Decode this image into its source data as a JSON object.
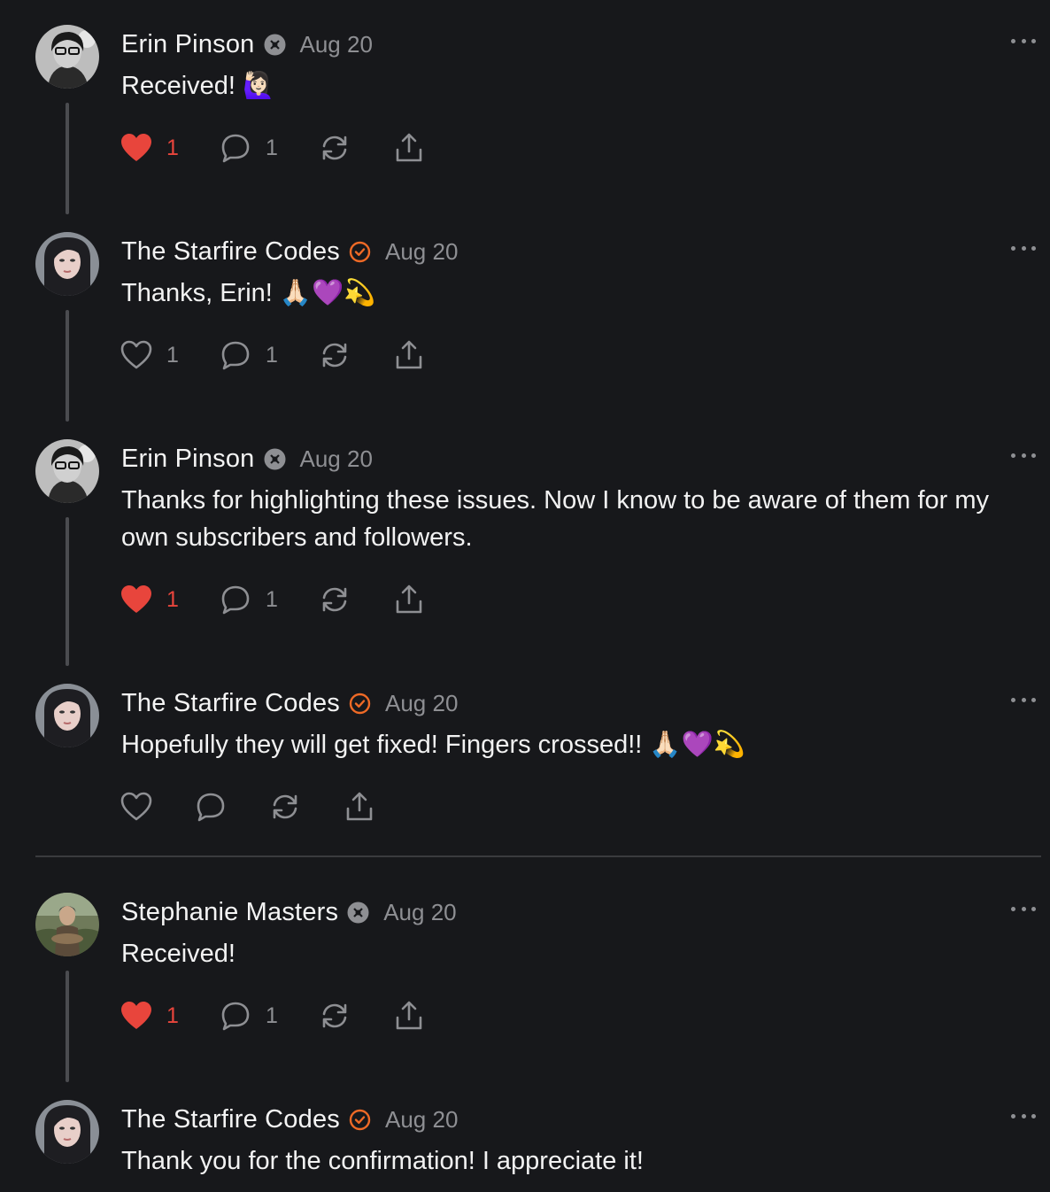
{
  "posts": [
    {
      "name": "Erin Pinson",
      "badge": "community-badge",
      "date": "Aug 20",
      "text": "Received! 🙋🏻‍♀️",
      "likes": "1",
      "liked": true,
      "comments": "1",
      "avatar": "erin"
    },
    {
      "name": "The Starfire Codes",
      "badge": "verified-badge",
      "date": "Aug 20",
      "text": "Thanks, Erin! 🙏🏻💜💫",
      "likes": "1",
      "liked": false,
      "comments": "1",
      "avatar": "starfire"
    },
    {
      "name": "Erin Pinson",
      "badge": "community-badge",
      "date": "Aug 20",
      "text": "Thanks for highlighting these issues. Now I know to be aware of them for my own subscribers and followers.",
      "likes": "1",
      "liked": true,
      "comments": "1",
      "avatar": "erin"
    },
    {
      "name": "The Starfire Codes",
      "badge": "verified-badge",
      "date": "Aug 20",
      "text": "Hopefully they will get fixed! Fingers crossed!! 🙏🏻💜💫",
      "likes": "",
      "liked": false,
      "comments": "",
      "avatar": "starfire"
    },
    {
      "name": "Stephanie Masters",
      "badge": "community-badge",
      "date": "Aug 20",
      "text": "Received!",
      "likes": "1",
      "liked": true,
      "comments": "1",
      "avatar": "stephanie"
    },
    {
      "name": "The Starfire Codes",
      "badge": "verified-badge",
      "date": "Aug 20",
      "text": "Thank you for the confirmation! I appreciate it!",
      "likes": "",
      "liked": false,
      "comments": "",
      "avatar": "starfire"
    }
  ],
  "icons": {
    "like": "heart-icon",
    "comment": "comment-icon",
    "restack": "restack-icon",
    "share": "share-icon",
    "more": "more-options-icon"
  },
  "colors": {
    "background": "#17181b",
    "like_active": "#e8453c",
    "verified": "#ef6a26",
    "muted": "#8e8f93"
  }
}
